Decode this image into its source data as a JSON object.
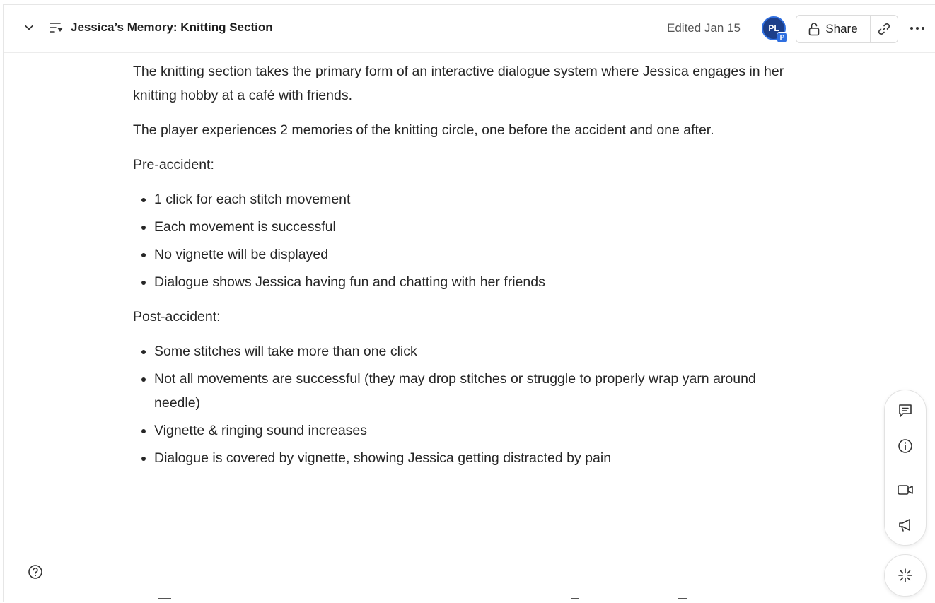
{
  "header": {
    "title": "Jessica’s Memory: Knitting Section",
    "edited": "Edited Jan 15",
    "avatar_initials": "PL",
    "avatar_badge": "P",
    "share_label": "Share"
  },
  "content": {
    "intro": "The knitting section takes the primary form of an interactive dialogue system where Jessica engages in her knitting hobby at a café with friends.",
    "summary": "The player experiences 2 memories of the knitting circle, one before the accident and one after.",
    "pre_heading": "Pre-accident:",
    "pre_items": [
      "1 click for each stitch movement",
      "Each movement is successful",
      "No vignette will be displayed",
      "Dialogue shows Jessica having fun and chatting with her friends"
    ],
    "post_heading": "Post-accident:",
    "post_items": [
      "Some stitches will take more than one click",
      "Not all movements are successful (they may drop stitches or struggle to properly wrap yarn around needle)",
      "Vignette & ringing sound increases",
      "Dialogue is covered by vignette, showing Jessica getting distracted by pain"
    ]
  },
  "icons": {
    "collapse": "chevron-down-icon",
    "doc": "doc-outline-icon",
    "lock": "unlock-icon",
    "link": "link-icon",
    "more": "more-horizontal-icon",
    "comments": "comment-icon",
    "info": "info-icon",
    "video": "video-icon",
    "announce": "megaphone-icon",
    "ai": "sparkle-icon",
    "help": "help-icon"
  },
  "colors": {
    "avatar_bg": "#1d3f8a",
    "avatar_ring": "#2f6fe0",
    "text": "#262626",
    "muted": "#555555"
  }
}
